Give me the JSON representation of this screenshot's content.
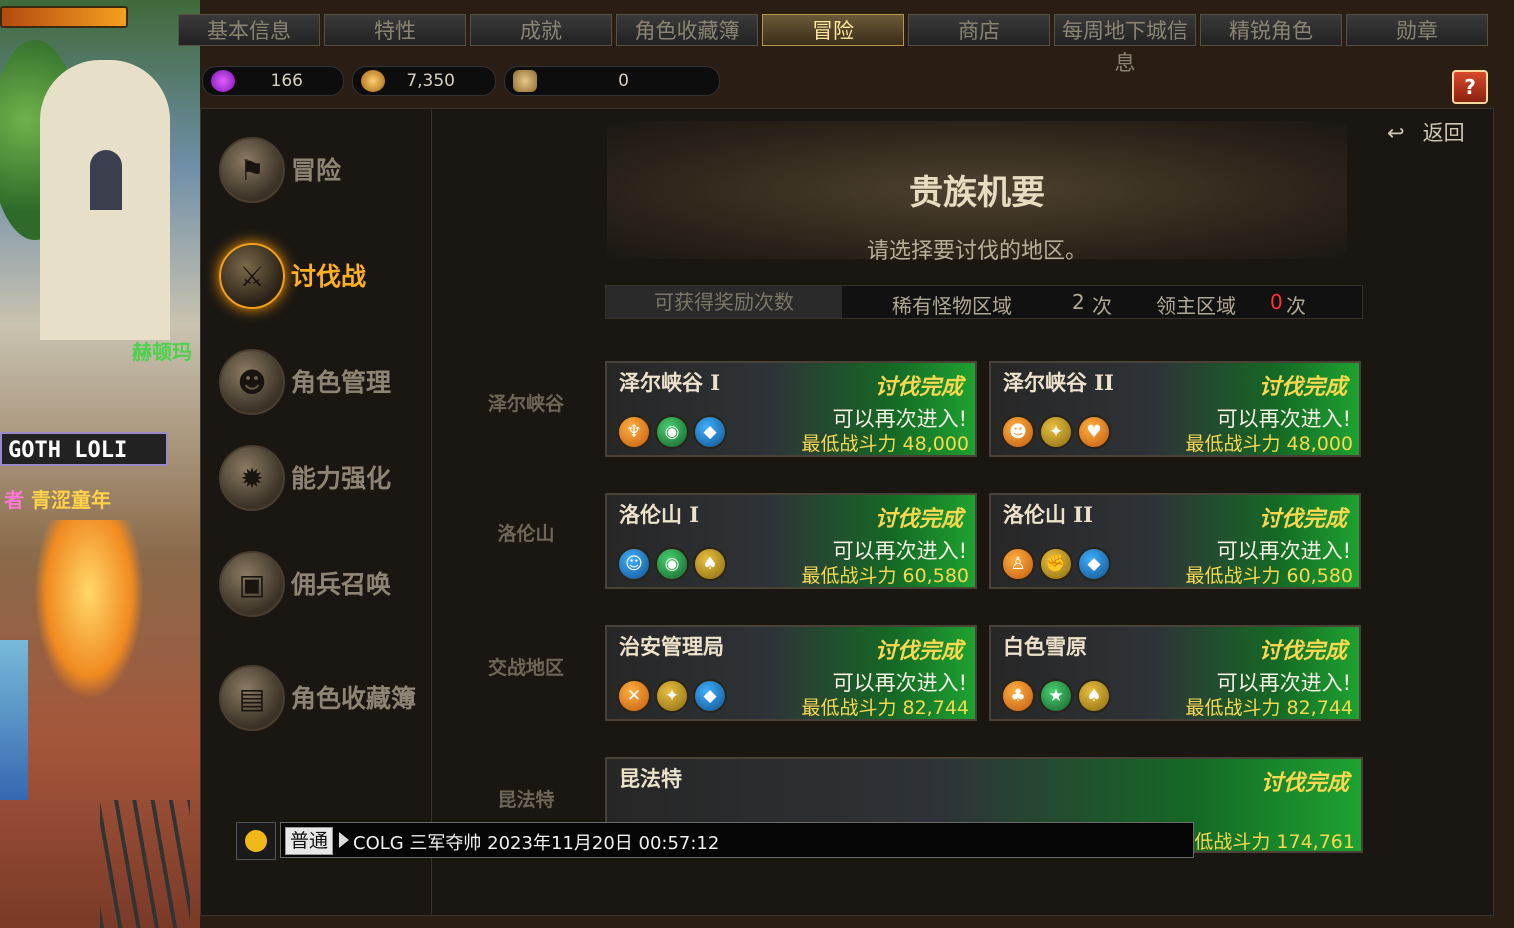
{
  "tabs": [
    "基本信息",
    "特性",
    "成就",
    "角色收藏簿",
    "冒险",
    "商店",
    "每周地下城信息",
    "精锐角色",
    "勋章"
  ],
  "active_tab": 4,
  "currency": [
    {
      "icon": "purple-gem-icon",
      "value": "166"
    },
    {
      "icon": "gold-coin-icon",
      "value": "7,350"
    },
    {
      "icon": "token-stack-icon",
      "value": "0"
    }
  ],
  "scene": {
    "sign": "赫顿玛",
    "nameplate": "GOTH LOLI",
    "guild_prefix": "者",
    "guild_name": "青涩童年"
  },
  "sidebar": [
    {
      "label": "冒险",
      "icon": "banner-icon",
      "active": false
    },
    {
      "label": "讨伐战",
      "icon": "crossed-swords-icon",
      "active": true
    },
    {
      "label": "角色管理",
      "icon": "character-icon",
      "active": false
    },
    {
      "label": "能力强化",
      "icon": "star-burst-icon",
      "active": false
    },
    {
      "label": "佣兵召唤",
      "icon": "chest-icon",
      "active": false
    },
    {
      "label": "角色收藏簿",
      "icon": "album-icon",
      "active": false
    }
  ],
  "back_label": "返回",
  "title": "贵族机要",
  "subtitle": "请选择要讨伐的地区。",
  "rewards": {
    "label": "可获得奖励次数",
    "rare_label": "稀有怪物区域",
    "rare_count": "2",
    "lord_label": "领主区域",
    "lord_count": "0",
    "unit": "次"
  },
  "regions": [
    {
      "label": "泽尔峡谷",
      "cards": [
        {
          "name": "泽尔峡谷 I",
          "status": "讨伐完成",
          "reenter": "可以再次进入!",
          "power": "最低战斗力 48,000",
          "icons": [
            "orange",
            "green",
            "blue"
          ]
        },
        {
          "name": "泽尔峡谷 II",
          "status": "讨伐完成",
          "reenter": "可以再次进入!",
          "power": "最低战斗力 48,000",
          "icons": [
            "orange",
            "gold",
            "orange"
          ]
        }
      ]
    },
    {
      "label": "洛伦山",
      "cards": [
        {
          "name": "洛伦山 I",
          "status": "讨伐完成",
          "reenter": "可以再次进入!",
          "power": "最低战斗力 60,580",
          "icons": [
            "blue",
            "green",
            "gold"
          ]
        },
        {
          "name": "洛伦山 II",
          "status": "讨伐完成",
          "reenter": "可以再次进入!",
          "power": "最低战斗力 60,580",
          "icons": [
            "orange",
            "gold",
            "blue"
          ]
        }
      ]
    },
    {
      "label": "交战地区",
      "cards": [
        {
          "name": "治安管理局",
          "status": "讨伐完成",
          "reenter": "可以再次进入!",
          "power": "最低战斗力 82,744",
          "icons": [
            "orange",
            "gold",
            "blue"
          ]
        },
        {
          "name": "白色雪原",
          "status": "讨伐完成",
          "reenter": "可以再次进入!",
          "power": "最低战斗力 82,744",
          "icons": [
            "orange",
            "green",
            "gold"
          ]
        }
      ]
    },
    {
      "label": "昆法特",
      "cards": [
        {
          "name": "昆法特",
          "status": "讨伐完成",
          "power": "最低战斗力 174,761"
        }
      ]
    }
  ],
  "chat": {
    "mode": "普通",
    "message": "COLG 三军夺帅 2023年11月20日 00:57:12"
  }
}
